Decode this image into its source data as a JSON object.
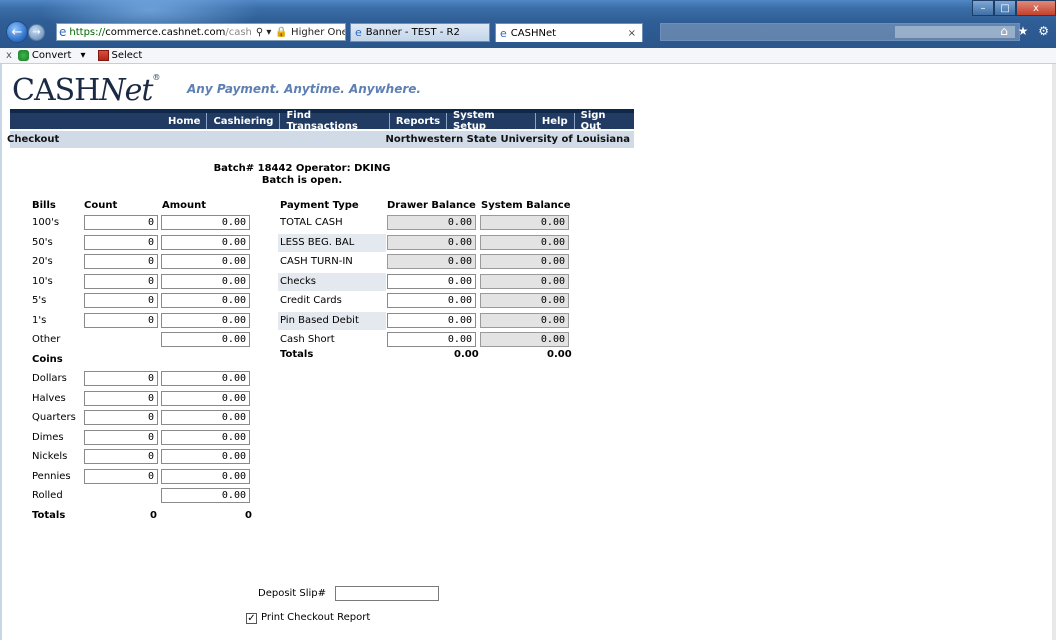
{
  "browser": {
    "url_scheme": "https://",
    "url_host": "commerce.cashnet.com",
    "url_path": "/cash",
    "search_glyph": "⚲ ▾",
    "security_text": "🔒 Higher One... ",
    "tabs": [
      {
        "label": "Banner - TEST - R2"
      },
      {
        "label": "CASHNet"
      }
    ],
    "tab_close": "×",
    "window_buttons": {
      "minimize": "–",
      "maximize": "□",
      "close": "x"
    },
    "right_icons": "⌂ ★ ⚙"
  },
  "command_bar": {
    "close_glyph": "x",
    "convert_label": "Convert",
    "convert_arrow": "▾",
    "select_label": "Select"
  },
  "header": {
    "logo_cash": "CASH",
    "logo_net": "Net",
    "logo_mark": "®",
    "tagline": "Any Payment. Anytime. Anywhere."
  },
  "nav": [
    "Home",
    "Cashiering",
    "Find Transactions",
    "Reports",
    "System Setup",
    "Help",
    "Sign Out"
  ],
  "subbar": {
    "left": "Checkout",
    "right": "Northwestern State University of Louisiana"
  },
  "batch": {
    "line1": "Batch# 18442  Operator: DKING",
    "line2": "Batch is open."
  },
  "bills": {
    "headers": {
      "label": "Bills",
      "count": "Count",
      "amount": "Amount"
    },
    "rows": [
      {
        "label": "100's",
        "count": "0",
        "amount": "0.00"
      },
      {
        "label": "50's",
        "count": "0",
        "amount": "0.00"
      },
      {
        "label": "20's",
        "count": "0",
        "amount": "0.00"
      },
      {
        "label": "10's",
        "count": "0",
        "amount": "0.00"
      },
      {
        "label": "5's",
        "count": "0",
        "amount": "0.00"
      },
      {
        "label": "1's",
        "count": "0",
        "amount": "0.00"
      },
      {
        "label": "Other",
        "count": null,
        "amount": "0.00"
      }
    ]
  },
  "coins": {
    "header": "Coins",
    "rows": [
      {
        "label": "Dollars",
        "count": "0",
        "amount": "0.00"
      },
      {
        "label": "Halves",
        "count": "0",
        "amount": "0.00"
      },
      {
        "label": "Quarters",
        "count": "0",
        "amount": "0.00"
      },
      {
        "label": "Dimes",
        "count": "0",
        "amount": "0.00"
      },
      {
        "label": "Nickels",
        "count": "0",
        "amount": "0.00"
      },
      {
        "label": "Pennies",
        "count": "0",
        "amount": "0.00"
      },
      {
        "label": "Rolled",
        "count": null,
        "amount": "0.00"
      }
    ],
    "totals": {
      "label": "Totals",
      "count": "0",
      "amount": "0"
    }
  },
  "payments": {
    "headers": {
      "type": "Payment Type",
      "drawer": "Drawer Balance",
      "system": "System Balance"
    },
    "rows": [
      {
        "label": "TOTAL CASH",
        "drawer": "0.00",
        "system": "0.00",
        "drawer_editable": false,
        "shade": false
      },
      {
        "label": "LESS BEG. BAL",
        "drawer": "0.00",
        "system": "0.00",
        "drawer_editable": false,
        "shade": true
      },
      {
        "label": "CASH TURN-IN",
        "drawer": "0.00",
        "system": "0.00",
        "drawer_editable": false,
        "shade": false
      },
      {
        "label": "Checks",
        "drawer": "0.00",
        "system": "0.00",
        "drawer_editable": true,
        "shade": true
      },
      {
        "label": "Credit Cards",
        "drawer": "0.00",
        "system": "0.00",
        "drawer_editable": true,
        "shade": false
      },
      {
        "label": "Pin Based Debit",
        "drawer": "0.00",
        "system": "0.00",
        "drawer_editable": true,
        "shade": true
      },
      {
        "label": "Cash Short",
        "drawer": "0.00",
        "system": "0.00",
        "drawer_editable": true,
        "shade": false
      }
    ],
    "totals": {
      "label": "Totals",
      "drawer": "0.00",
      "system": "0.00"
    }
  },
  "deposit": {
    "label": "Deposit Slip#",
    "value": ""
  },
  "print_report": {
    "label": "Print Checkout Report",
    "checked": true,
    "check_glyph": "✓"
  }
}
